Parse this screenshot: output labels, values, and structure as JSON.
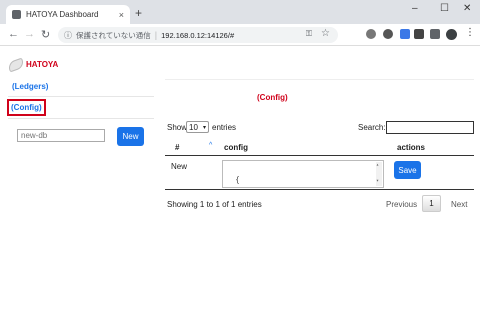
{
  "browser": {
    "tab_title": "HATOYA Dashboard",
    "tab_close": "×",
    "new_tab": "+",
    "win_minimize": "–",
    "win_maximize": "☐",
    "win_close": "✕",
    "back": "←",
    "forward": "→",
    "reload": "↻",
    "info_icon": "ⓘ",
    "security_text": "保護されていない通信",
    "url": "192.168.0.12:14126/#",
    "key_icon": "⚿",
    "star_icon": "☆",
    "menu_icon": "⋮",
    "extensions": [
      "extension-icon-1",
      "extension-icon-2",
      "extension-icon-3",
      "extension-icon-4",
      "puzzle-icon"
    ]
  },
  "sidebar": {
    "logo_text": "HATOYA",
    "items": [
      {
        "label": "(Ledgers)"
      },
      {
        "label": "(Config)"
      }
    ],
    "new_db_placeholder": "new-db",
    "new_button": "New"
  },
  "main": {
    "heading": "(Config)",
    "show_label": "Show",
    "page_size": "10",
    "entries_label": "entries",
    "search_label": "Search:",
    "columns": [
      "#",
      "config",
      "actions"
    ],
    "sort_indicator": "^",
    "rows": [
      {
        "num": "New",
        "config": "{\n  \"name\":\"name\",",
        "action": "Save"
      }
    ],
    "info": "Showing 1 to 1 of 1 entries",
    "prev": "Previous",
    "current_page": "1",
    "next": "Next"
  },
  "colors": {
    "accent": "#1a73e8",
    "brand_red": "#d0021b"
  }
}
